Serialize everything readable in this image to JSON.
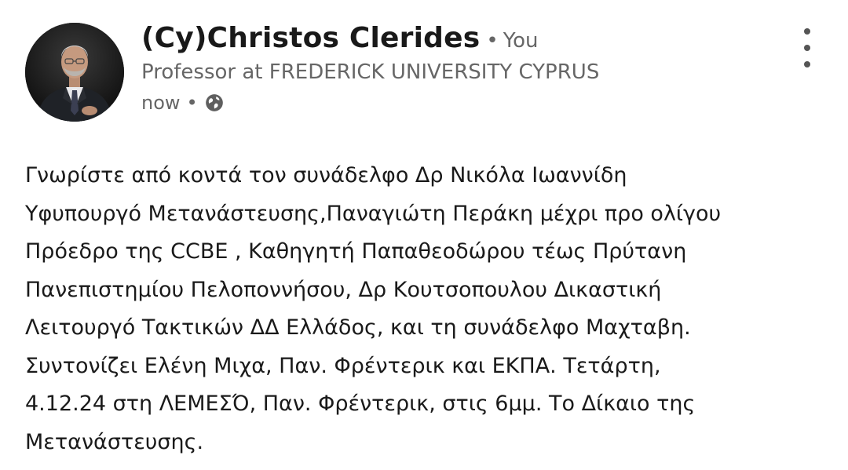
{
  "author": {
    "name": "(Cy)Christos Clerides",
    "separator": "•",
    "you_label": "You",
    "headline": "Professor at FREDERICK UNIVERSITY CYPRUS"
  },
  "meta": {
    "time": "now",
    "separator": "•",
    "visibility_icon": "globe-icon"
  },
  "menu": {
    "icon": "more-vertical-icon"
  },
  "post": {
    "lines": [
      "Γνωρίστε από κοντά τον συνάδελφο Δρ Νικόλα Ιωαννίδη",
      "Υφυπουργό Μετανάστευσης,Παναγιώτη Περάκη μέχρι προ ολίγου",
      "Πρόεδρο της CCBE , Καθηγητή Παπαθεοδώρου τέως Πρύτανη",
      "Πανεπιστημίου Πελοποννήσου, Δρ Κουτσοπουλου Δικαστική",
      "Λειτουργό Τακτικών ΔΔ Ελλάδος, και τη συνάδελφο Μαχταβη.",
      "Συντονίζει Ελένη Μιχα, Παν. Φρέντερικ  και ΕΚΠΑ. Τετάρτη,",
      "4.12.24 στη ΛΕΜΕΣΌ, Παν. Φρέντερικ, στις 6μμ. Το Δίκαιο της",
      "Μετανάστευσης."
    ]
  }
}
